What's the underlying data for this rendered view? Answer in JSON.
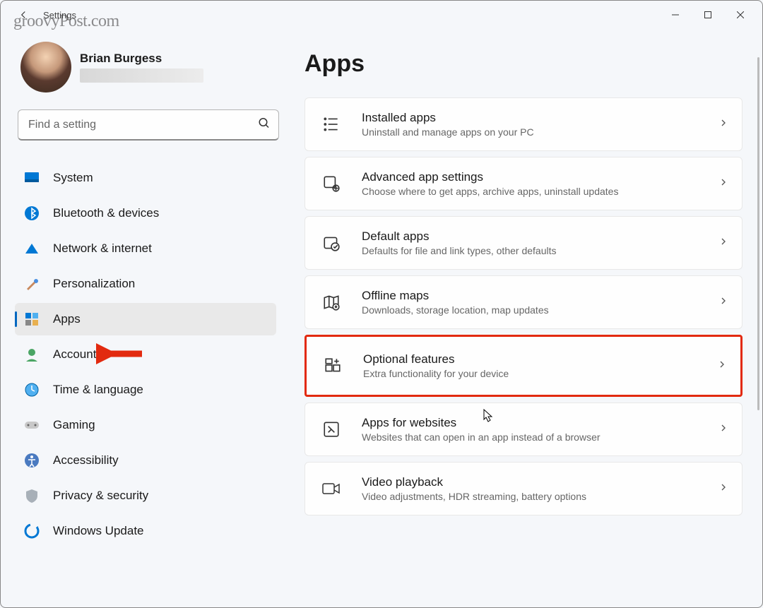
{
  "watermark": "groovyPost.com",
  "window": {
    "title": "Settings"
  },
  "user": {
    "name": "Brian Burgess"
  },
  "search": {
    "placeholder": "Find a setting"
  },
  "nav": [
    {
      "label": "System",
      "icon": "system"
    },
    {
      "label": "Bluetooth & devices",
      "icon": "bluetooth"
    },
    {
      "label": "Network & internet",
      "icon": "network"
    },
    {
      "label": "Personalization",
      "icon": "personalization"
    },
    {
      "label": "Apps",
      "icon": "apps",
      "active": true
    },
    {
      "label": "Accounts",
      "icon": "accounts"
    },
    {
      "label": "Time & language",
      "icon": "time"
    },
    {
      "label": "Gaming",
      "icon": "gaming"
    },
    {
      "label": "Accessibility",
      "icon": "accessibility"
    },
    {
      "label": "Privacy & security",
      "icon": "privacy"
    },
    {
      "label": "Windows Update",
      "icon": "update"
    }
  ],
  "page": {
    "title": "Apps"
  },
  "cards": [
    {
      "title": "Installed apps",
      "desc": "Uninstall and manage apps on your PC",
      "icon": "installed"
    },
    {
      "title": "Advanced app settings",
      "desc": "Choose where to get apps, archive apps, uninstall updates",
      "icon": "advanced"
    },
    {
      "title": "Default apps",
      "desc": "Defaults for file and link types, other defaults",
      "icon": "default"
    },
    {
      "title": "Offline maps",
      "desc": "Downloads, storage location, map updates",
      "icon": "maps"
    },
    {
      "title": "Optional features",
      "desc": "Extra functionality for your device",
      "icon": "optional",
      "highlighted": true
    },
    {
      "title": "Apps for websites",
      "desc": "Websites that can open in an app instead of a browser",
      "icon": "websites"
    },
    {
      "title": "Video playback",
      "desc": "Video adjustments, HDR streaming, battery options",
      "icon": "video"
    }
  ]
}
